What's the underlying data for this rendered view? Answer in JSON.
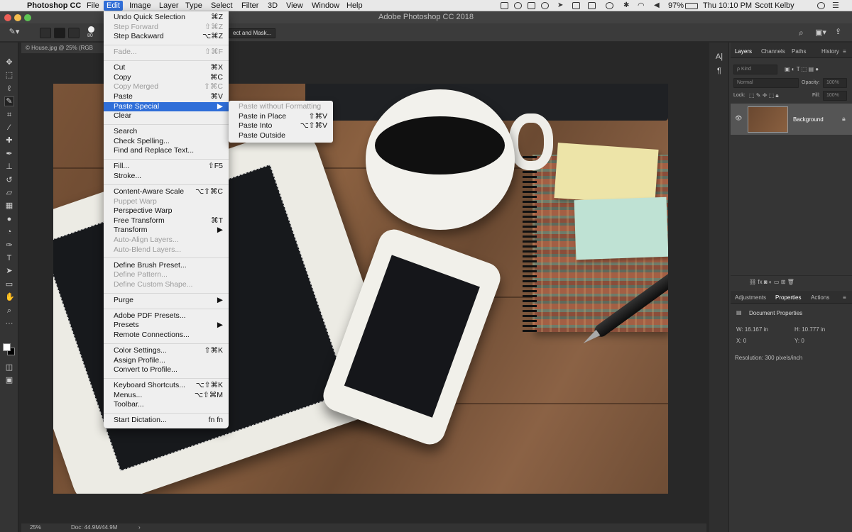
{
  "menubar": {
    "app": "Photoshop CC",
    "items": [
      "File",
      "Edit",
      "Image",
      "Layer",
      "Type",
      "Select",
      "Filter",
      "3D",
      "View",
      "Window",
      "Help"
    ],
    "active_index": 1,
    "battery": "97%",
    "clock": "Thu 10:10 PM",
    "user": "Scott Kelby"
  },
  "window": {
    "title": "Adobe Photoshop CC 2018"
  },
  "options": {
    "brush_size": "80",
    "select_mask_label": "ect and Mask..."
  },
  "doc_tab": {
    "label": "© House.jpg @ 25% (RGB"
  },
  "status": {
    "zoom": "25%",
    "doc": "Doc: 44.9M/44.9M"
  },
  "edit_menu": [
    {
      "label": "Undo Quick Selection",
      "shortcut": "⌘Z",
      "disabled": false
    },
    {
      "label": "Step Forward",
      "shortcut": "⇧⌘Z",
      "disabled": true
    },
    {
      "label": "Step Backward",
      "shortcut": "⌥⌘Z",
      "disabled": false
    },
    {
      "sep": true
    },
    {
      "label": "Fade...",
      "shortcut": "⇧⌘F",
      "disabled": true
    },
    {
      "sep": true
    },
    {
      "label": "Cut",
      "shortcut": "⌘X",
      "disabled": false
    },
    {
      "label": "Copy",
      "shortcut": "⌘C",
      "disabled": false
    },
    {
      "label": "Copy Merged",
      "shortcut": "⇧⌘C",
      "disabled": true
    },
    {
      "label": "Paste",
      "shortcut": "⌘V",
      "disabled": false
    },
    {
      "label": "Paste Special",
      "shortcut": "▶",
      "disabled": false,
      "highlight": true
    },
    {
      "label": "Clear",
      "shortcut": "",
      "disabled": false
    },
    {
      "sep": true
    },
    {
      "label": "Search",
      "shortcut": "",
      "disabled": false
    },
    {
      "label": "Check Spelling...",
      "shortcut": "",
      "disabled": false
    },
    {
      "label": "Find and Replace Text...",
      "shortcut": "",
      "disabled": false
    },
    {
      "sep": true
    },
    {
      "label": "Fill...",
      "shortcut": "⇧F5",
      "disabled": false
    },
    {
      "label": "Stroke...",
      "shortcut": "",
      "disabled": false
    },
    {
      "sep": true
    },
    {
      "label": "Content-Aware Scale",
      "shortcut": "⌥⇧⌘C",
      "disabled": false
    },
    {
      "label": "Puppet Warp",
      "shortcut": "",
      "disabled": true
    },
    {
      "label": "Perspective Warp",
      "shortcut": "",
      "disabled": false
    },
    {
      "label": "Free Transform",
      "shortcut": "⌘T",
      "disabled": false
    },
    {
      "label": "Transform",
      "shortcut": "▶",
      "disabled": false
    },
    {
      "label": "Auto-Align Layers...",
      "shortcut": "",
      "disabled": true
    },
    {
      "label": "Auto-Blend Layers...",
      "shortcut": "",
      "disabled": true
    },
    {
      "sep": true
    },
    {
      "label": "Define Brush Preset...",
      "shortcut": "",
      "disabled": false
    },
    {
      "label": "Define Pattern...",
      "shortcut": "",
      "disabled": true
    },
    {
      "label": "Define Custom Shape...",
      "shortcut": "",
      "disabled": true
    },
    {
      "sep": true
    },
    {
      "label": "Purge",
      "shortcut": "▶",
      "disabled": false
    },
    {
      "sep": true
    },
    {
      "label": "Adobe PDF Presets...",
      "shortcut": "",
      "disabled": false
    },
    {
      "label": "Presets",
      "shortcut": "▶",
      "disabled": false
    },
    {
      "label": "Remote Connections...",
      "shortcut": "",
      "disabled": false
    },
    {
      "sep": true
    },
    {
      "label": "Color Settings...",
      "shortcut": "⇧⌘K",
      "disabled": false
    },
    {
      "label": "Assign Profile...",
      "shortcut": "",
      "disabled": false
    },
    {
      "label": "Convert to Profile...",
      "shortcut": "",
      "disabled": false
    },
    {
      "sep": true
    },
    {
      "label": "Keyboard Shortcuts...",
      "shortcut": "⌥⇧⌘K",
      "disabled": false
    },
    {
      "label": "Menus...",
      "shortcut": "⌥⇧⌘M",
      "disabled": false
    },
    {
      "label": "Toolbar...",
      "shortcut": "",
      "disabled": false
    },
    {
      "sep": true
    },
    {
      "label": "Start Dictation...",
      "shortcut": "fn fn",
      "disabled": false
    }
  ],
  "paste_special_menu": [
    {
      "label": "Paste without Formatting",
      "shortcut": "",
      "disabled": true
    },
    {
      "label": "Paste in Place",
      "shortcut": "⇧⌘V",
      "disabled": false
    },
    {
      "label": "Paste Into",
      "shortcut": "⌥⇧⌘V",
      "disabled": false
    },
    {
      "label": "Paste Outside",
      "shortcut": "",
      "disabled": false
    }
  ],
  "layers_panel": {
    "tabs": [
      "Layers",
      "Channels",
      "Paths",
      "History"
    ],
    "filter_placeholder": "Kind",
    "blend_mode": "Normal",
    "opacity_label": "Opacity:",
    "opacity_value": "100%",
    "lock_label": "Lock:",
    "fill_label": "Fill:",
    "fill_value": "100%",
    "layer_name": "Background"
  },
  "properties_panel": {
    "tabs": [
      "Adjustments",
      "Properties",
      "Actions"
    ],
    "title": "Document Properties",
    "w": "W: 16.167 in",
    "h": "H: 10.777 in",
    "x": "X: 0",
    "y": "Y: 0",
    "resolution": "Resolution: 300 pixels/inch"
  },
  "colors": {
    "accent": "#2f6ed8",
    "panel": "#353535",
    "canvas_bg": "#282828"
  }
}
